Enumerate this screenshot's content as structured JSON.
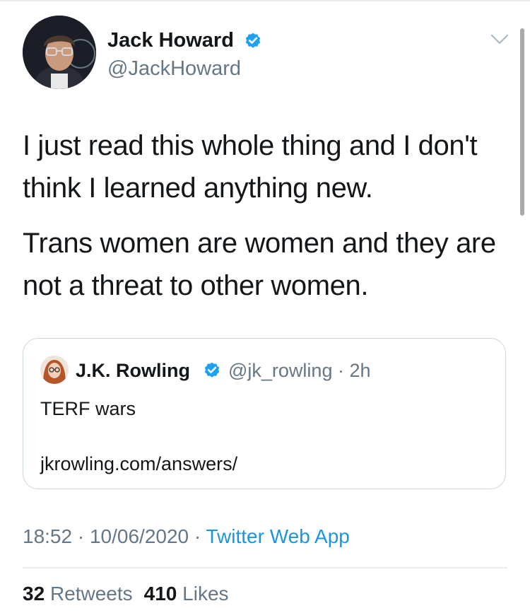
{
  "author": {
    "name": "Jack Howard",
    "handle": "@JackHoward",
    "verified": true,
    "avatar_icon": "profile-photo-man-with-glasses"
  },
  "tweet": {
    "paragraphs": [
      "I just read this whole thing and I don't think I learned anything new.",
      "Trans women are women and they are not a threat to other women."
    ]
  },
  "quoted_tweet": {
    "name": "J.K. Rowling",
    "handle": "@jk_rowling",
    "time": "· 2h",
    "verified": true,
    "text": "TERF wars",
    "link": "jkrowling.com/answers/"
  },
  "meta": {
    "time": "18:52",
    "separator1": "·",
    "date": "10/06/2020",
    "separator2": "·",
    "app": "Twitter Web App"
  },
  "stats": {
    "retweets_count": "32",
    "retweets_label": "Retweets",
    "likes_count": "410",
    "likes_label": "Likes"
  },
  "colors": {
    "verified": "#1da1f2",
    "link": "#1b95e0",
    "secondary_text": "#657786",
    "border": "#ccd6dd"
  }
}
